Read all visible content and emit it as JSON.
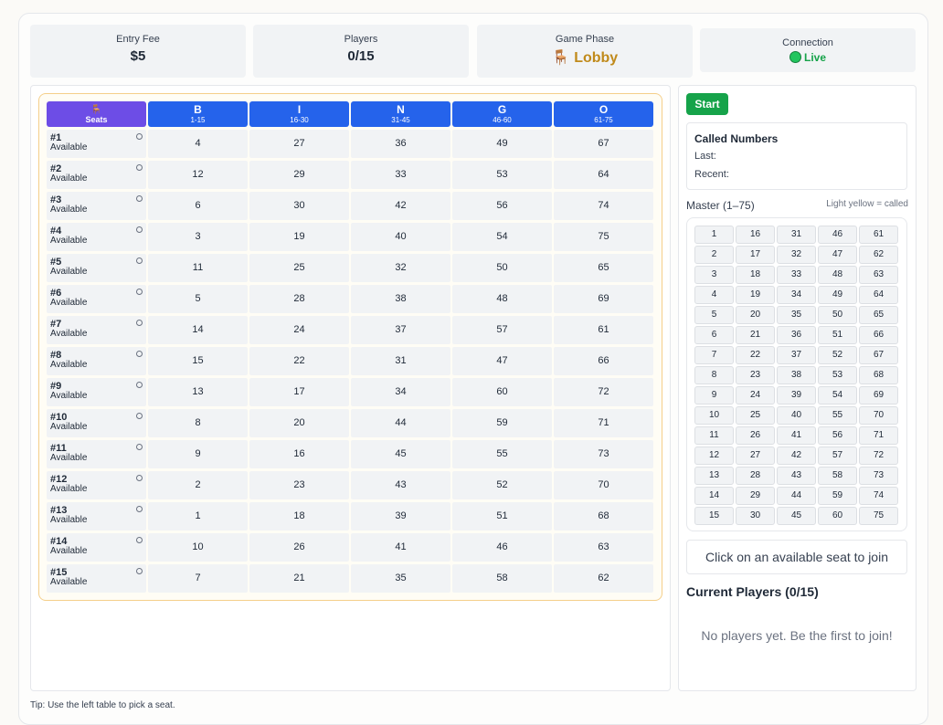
{
  "stats": {
    "entry_fee_label": "Entry Fee",
    "entry_fee_value": "$5",
    "players_label": "Players",
    "players_value": "0/15",
    "phase_label": "Game Phase",
    "phase_icon": "🪑",
    "phase_value": "Lobby",
    "connection_label": "Connection",
    "connection_value": "Live"
  },
  "board": {
    "seats_header_icon": "🪑",
    "seats_header_label": "Seats",
    "columns": [
      {
        "letter": "B",
        "range": "1-15"
      },
      {
        "letter": "I",
        "range": "16-30"
      },
      {
        "letter": "N",
        "range": "31-45"
      },
      {
        "letter": "G",
        "range": "46-60"
      },
      {
        "letter": "O",
        "range": "61-75"
      }
    ],
    "rows": [
      {
        "seat": "#1",
        "status": "Available",
        "nums": [
          "4",
          "27",
          "36",
          "49",
          "67"
        ]
      },
      {
        "seat": "#2",
        "status": "Available",
        "nums": [
          "12",
          "29",
          "33",
          "53",
          "64"
        ]
      },
      {
        "seat": "#3",
        "status": "Available",
        "nums": [
          "6",
          "30",
          "42",
          "56",
          "74"
        ]
      },
      {
        "seat": "#4",
        "status": "Available",
        "nums": [
          "3",
          "19",
          "40",
          "54",
          "75"
        ]
      },
      {
        "seat": "#5",
        "status": "Available",
        "nums": [
          "11",
          "25",
          "32",
          "50",
          "65"
        ]
      },
      {
        "seat": "#6",
        "status": "Available",
        "nums": [
          "5",
          "28",
          "38",
          "48",
          "69"
        ]
      },
      {
        "seat": "#7",
        "status": "Available",
        "nums": [
          "14",
          "24",
          "37",
          "57",
          "61"
        ]
      },
      {
        "seat": "#8",
        "status": "Available",
        "nums": [
          "15",
          "22",
          "31",
          "47",
          "66"
        ]
      },
      {
        "seat": "#9",
        "status": "Available",
        "nums": [
          "13",
          "17",
          "34",
          "60",
          "72"
        ]
      },
      {
        "seat": "#10",
        "status": "Available",
        "nums": [
          "8",
          "20",
          "44",
          "59",
          "71"
        ]
      },
      {
        "seat": "#11",
        "status": "Available",
        "nums": [
          "9",
          "16",
          "45",
          "55",
          "73"
        ]
      },
      {
        "seat": "#12",
        "status": "Available",
        "nums": [
          "2",
          "23",
          "43",
          "52",
          "70"
        ]
      },
      {
        "seat": "#13",
        "status": "Available",
        "nums": [
          "1",
          "18",
          "39",
          "51",
          "68"
        ]
      },
      {
        "seat": "#14",
        "status": "Available",
        "nums": [
          "10",
          "26",
          "41",
          "46",
          "63"
        ]
      },
      {
        "seat": "#15",
        "status": "Available",
        "nums": [
          "7",
          "21",
          "35",
          "58",
          "62"
        ]
      }
    ]
  },
  "controls": {
    "start_label": "Start"
  },
  "called": {
    "title": "Called Numbers",
    "last_label": "Last:",
    "recent_label": "Recent:"
  },
  "master": {
    "label": "Master (1–75)",
    "legend": "Light yellow = called",
    "called_numbers": []
  },
  "join_prompt": "Click on an available seat to join",
  "current_players_title": "Current Players (0/15)",
  "no_players_text": "No players yet. Be the first to join!",
  "tip": "Tip: Use the left table to pick a seat.",
  "colors": {
    "header_blue": "#2563eb",
    "header_purple": "#6d4de6",
    "live_green": "#16a34a",
    "lobby_gold": "#c08a1b",
    "called_yellow": "#fef3c7"
  }
}
